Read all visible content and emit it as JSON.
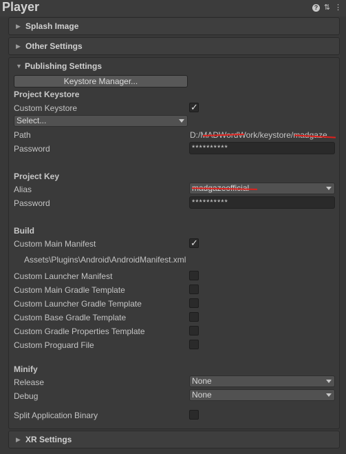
{
  "header": {
    "title": "Player",
    "icons": [
      "help-icon",
      "settings-sliders-icon",
      "more-icon"
    ]
  },
  "foldouts": {
    "splash_image": "Splash Image",
    "other_settings": "Other Settings",
    "publishing_settings": "Publishing Settings",
    "xr_settings": "XR Settings"
  },
  "publishing": {
    "keystore_manager_button": "Keystore Manager...",
    "project_keystore": {
      "title": "Project Keystore",
      "custom_keystore_label": "Custom Keystore",
      "custom_keystore_checked": true,
      "select_dropdown": "Select...",
      "path_label": "Path",
      "path_value": "D:/MADWordWork/keystore/madgaze",
      "password_label": "Password",
      "password_value": "**********"
    },
    "project_key": {
      "title": "Project Key",
      "alias_label": "Alias",
      "alias_value": "madgazeofficial",
      "password_label": "Password",
      "password_value": "**********"
    },
    "build": {
      "title": "Build",
      "custom_main_manifest_label": "Custom Main Manifest",
      "custom_main_manifest_checked": true,
      "manifest_path": "Assets\\Plugins\\Android\\AndroidManifest.xml",
      "options": [
        {
          "label": "Custom Launcher Manifest",
          "checked": false
        },
        {
          "label": "Custom Main Gradle Template",
          "checked": false
        },
        {
          "label": "Custom Launcher Gradle Template",
          "checked": false
        },
        {
          "label": "Custom Base Gradle Template",
          "checked": false
        },
        {
          "label": "Custom Gradle Properties Template",
          "checked": false
        },
        {
          "label": "Custom Proguard File",
          "checked": false
        }
      ]
    },
    "minify": {
      "title": "Minify",
      "release_label": "Release",
      "release_value": "None",
      "debug_label": "Debug",
      "debug_value": "None"
    },
    "split_binary_label": "Split Application Binary",
    "split_binary_checked": false
  },
  "colors": {
    "background": "#383838",
    "redaction": "#e0201c"
  }
}
